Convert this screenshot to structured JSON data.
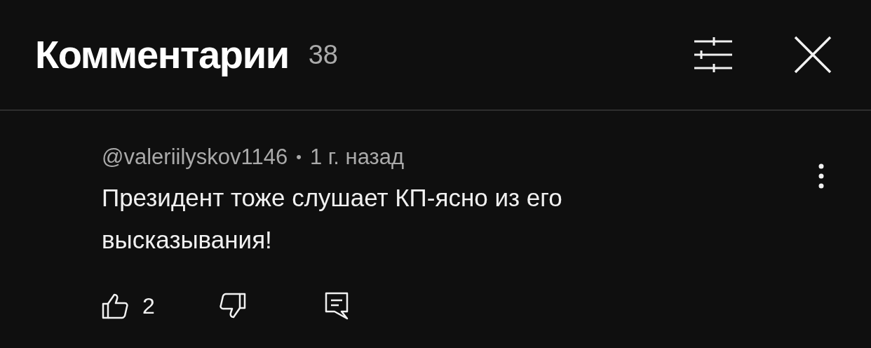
{
  "header": {
    "title": "Комментарии",
    "count": "38"
  },
  "comments": [
    {
      "author": "@valeriilyskov1146",
      "separator": "•",
      "time": "1 г. назад",
      "text": "Президент тоже слушает КП-ясно из его высказывания!",
      "likes": "2"
    }
  ]
}
